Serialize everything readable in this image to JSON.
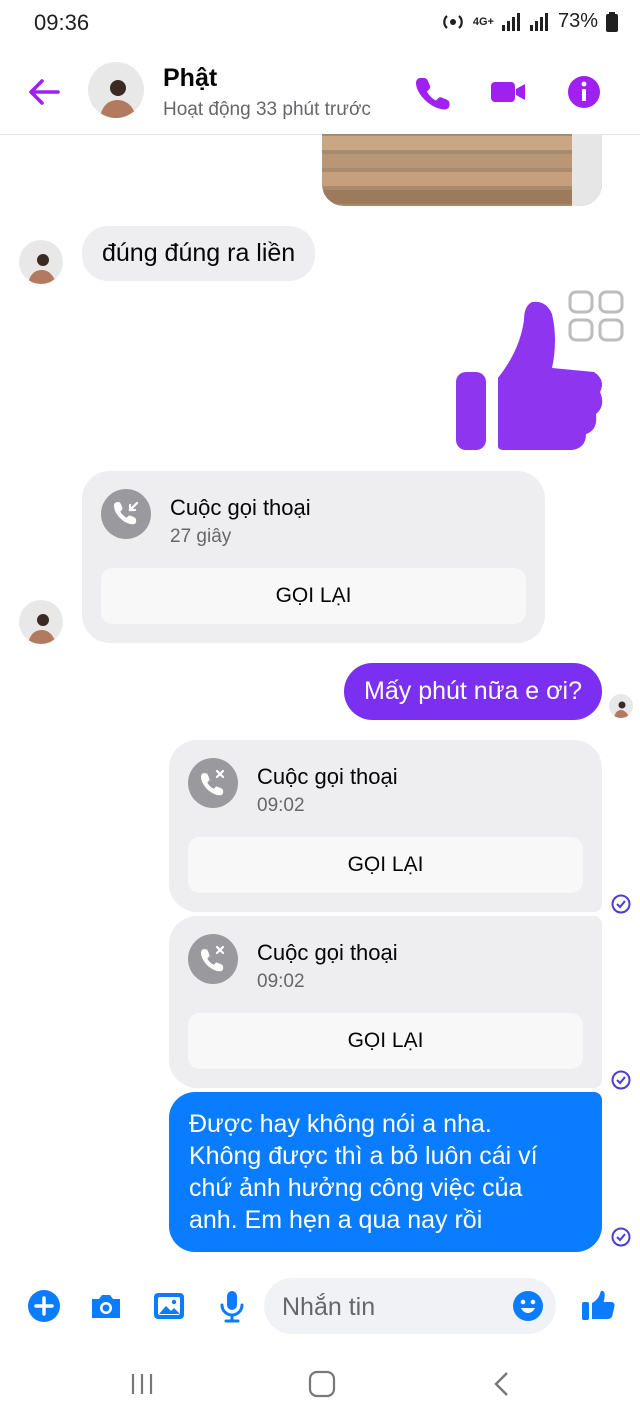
{
  "status_bar": {
    "time": "09:36",
    "network": "4G+",
    "battery": "73%"
  },
  "header": {
    "name": "Phật",
    "activity": "Hoạt động 33 phút trước",
    "icons": [
      "back-arrow-icon",
      "phone-icon",
      "video-camera-icon",
      "info-icon"
    ],
    "accent_color": "#a020f0"
  },
  "messages": {
    "incoming_text": "đúng đúng ra liền",
    "sticker": "thumbs-up-icon",
    "call_in": {
      "title": "Cuộc gọi thoại",
      "subtitle": "27 giây",
      "action": "GỌI LẠI"
    },
    "outgoing_question": "Mấy phút nữa e ơi?",
    "call_out_1": {
      "title": "Cuộc gọi thoại",
      "subtitle": "09:02",
      "action": "GỌI LẠI"
    },
    "call_out_2": {
      "title": "Cuộc gọi thoại",
      "subtitle": "09:02",
      "action": "GỌI LẠI"
    },
    "outgoing_long": [
      "Được hay không nói a nha.",
      "Không được thì a bỏ luôn cái ví",
      "chứ ảnh hưởng công việc của",
      "anh. Em hẹn a qua nay rồi"
    ]
  },
  "composer": {
    "placeholder": "Nhắn tin",
    "icons": [
      "plus-icon",
      "camera-icon",
      "gallery-icon",
      "microphone-icon",
      "emoji-icon",
      "like-icon"
    ]
  },
  "colors": {
    "purple_bubble": "#7b2ff0",
    "blue_bubble": "#0a7cff",
    "incoming_bubble": "#eeeef0"
  }
}
